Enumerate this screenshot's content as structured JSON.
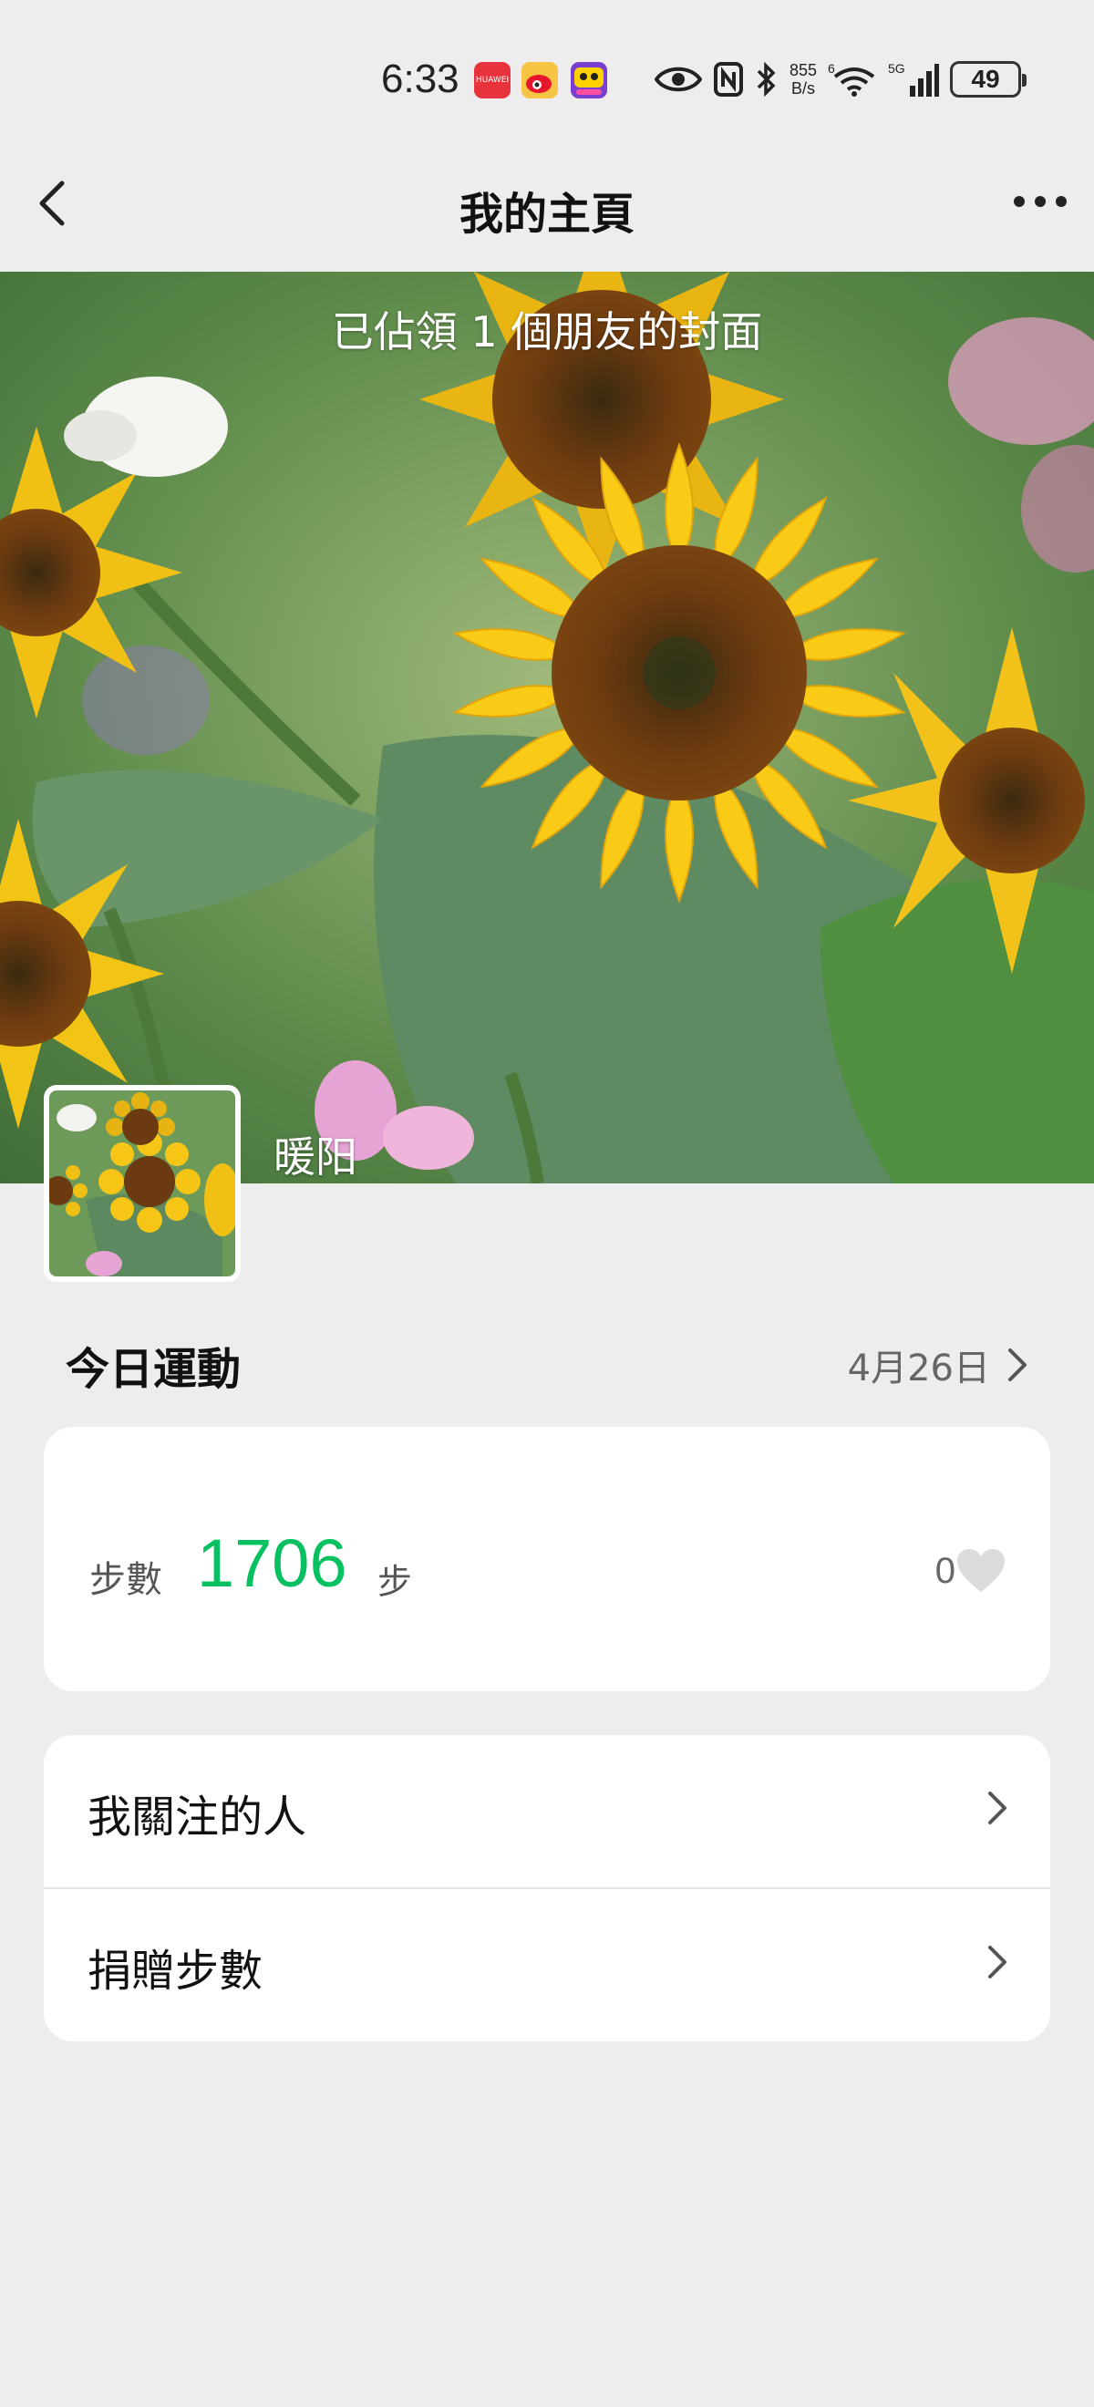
{
  "status_bar": {
    "time": "6:33",
    "apps": [
      {
        "name": "huawei-app-icon",
        "color": "#e8323c",
        "text": "HUAWEI"
      },
      {
        "name": "weibo-app-icon",
        "color": "#f6c443",
        "text": ""
      },
      {
        "name": "game-app-icon",
        "color": "#7a3fd1",
        "text": ""
      }
    ],
    "network_speed_value": "855",
    "network_speed_unit": "B/s",
    "wifi_label": "6",
    "signal_label": "5G",
    "battery": "49"
  },
  "nav": {
    "title": "我的主頁"
  },
  "cover": {
    "caption": "已佔領 1 個朋友的封面",
    "user_name": "暖阳"
  },
  "today": {
    "title": "今日運動",
    "date": "4月26日"
  },
  "steps": {
    "label": "步數",
    "value": "1706",
    "unit": "步",
    "likes": "0"
  },
  "menu": {
    "items": [
      {
        "label": "我關注的人"
      },
      {
        "label": "捐贈步數"
      }
    ]
  },
  "colors": {
    "accent_green": "#07c160",
    "background": "#ededed",
    "card": "#ffffff"
  }
}
